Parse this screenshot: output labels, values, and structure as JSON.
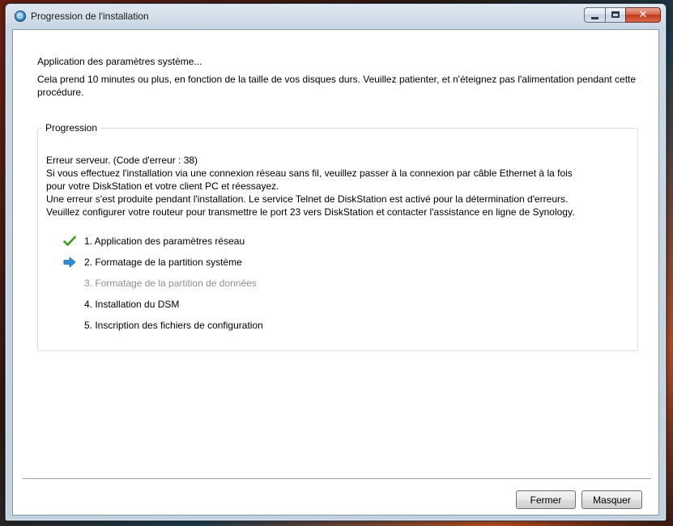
{
  "window": {
    "title": "Progression de l'installation",
    "close_glyph": "✕",
    "app_icon": "synology-assistant-icon"
  },
  "status": {
    "title": "Application des paramètres système...",
    "description": "Cela prend 10 minutes ou plus, en fonction de la taille de vos disques durs. Veuillez patienter, et n'éteignez pas l'alimentation pendant cette procédure."
  },
  "progress_group": {
    "legend": "Progression",
    "error_lines": [
      "Erreur serveur. (Code d'erreur : 38)",
      "Si vous effectuez l'installation via une connexion réseau sans fil, veuillez passer à la connexion par câble Ethernet à la fois",
      "pour votre DiskStation et votre client PC et réessayez.",
      "Une erreur s'est produite pendant l'installation. Le service Telnet de DiskStation est activé pour la détermination d'erreurs.",
      "Veuillez configurer votre routeur pour transmettre le port 23 vers DiskStation et contacter l'assistance en ligne de Synology."
    ],
    "steps": [
      {
        "label": "1. Application des paramètres réseau",
        "state": "done",
        "icon": "checkmark-icon"
      },
      {
        "label": "2. Formatage de la partition système",
        "state": "current",
        "icon": "arrow-right-icon"
      },
      {
        "label": "3. Formatage de la partition de données",
        "state": "pending",
        "icon": ""
      },
      {
        "label": "4. Installation du DSM",
        "state": "todo",
        "icon": ""
      },
      {
        "label": "5. Inscription des fichiers de configuration",
        "state": "todo",
        "icon": ""
      }
    ]
  },
  "footer": {
    "close_label": "Fermer",
    "hide_label": "Masquer"
  },
  "colors": {
    "check": "#3c9a1e",
    "arrow": "#2f8ed8",
    "pending_text": "#8e8e8e"
  }
}
